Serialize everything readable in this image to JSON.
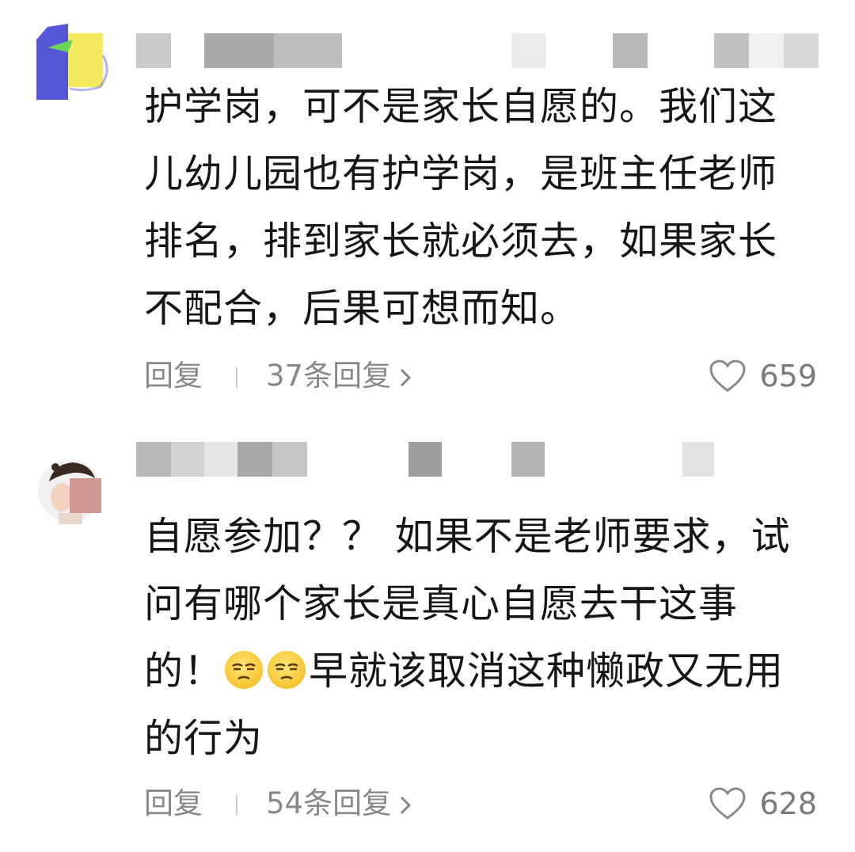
{
  "comments": [
    {
      "text": "护学岗，可不是家长自愿的。我们这儿幼儿园也有护学岗，是班主任老师排名，排到家长就必须去，如果家长不配合，后果可想而知。",
      "reply_label": "回复",
      "replies_label": "37条回复",
      "likes": "659"
    },
    {
      "text_before": "自愿参加？？ 如果不是老师要求，试问有哪个家长是真心自愿去干这事的！",
      "emojis": [
        "smirk-emoji",
        "smirk-emoji"
      ],
      "text_after": "早就该取消这种懒政又无用的行为",
      "reply_label": "回复",
      "replies_label": "54条回复",
      "likes": "628"
    }
  ],
  "icons": {
    "like": "heart-outline-icon",
    "more": "chevron-right-icon"
  },
  "colors": {
    "text": "#161616",
    "meta": "#888888",
    "like": "#7a7a7a"
  }
}
